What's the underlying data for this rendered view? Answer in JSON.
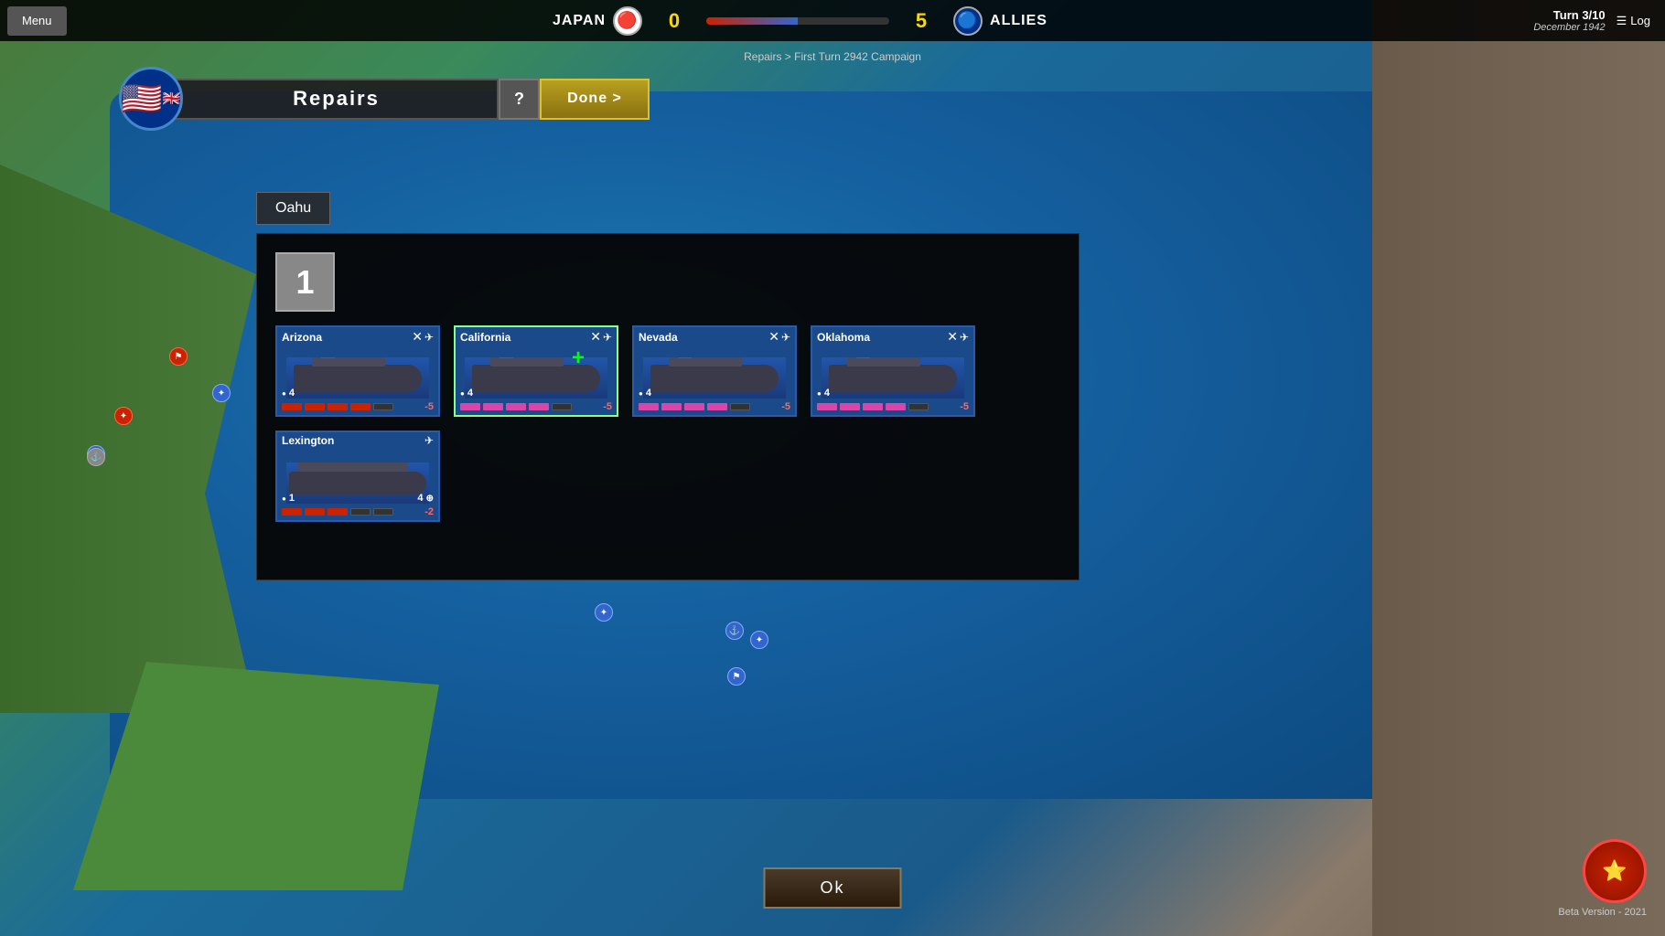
{
  "topbar": {
    "menu_label": "Menu",
    "japan_label": "JAPAN",
    "japan_score": "0",
    "allies_label": "ALLIES",
    "allies_score": "5",
    "turn_label": "Turn 3/10",
    "date_label": "December 1942",
    "log_label": "Log"
  },
  "breadcrumb": {
    "text": "Repairs > First Turn 2942 Campaign"
  },
  "repairs_header": {
    "title": "Repairs",
    "help_label": "?",
    "done_label": "Done >"
  },
  "location": {
    "name": "Oahu"
  },
  "repair_counter": {
    "value": "1"
  },
  "ships": [
    {
      "name": "Arizona",
      "stat_left": "4",
      "stat_right": "",
      "damage": "-5",
      "type": "battleship",
      "pips": [
        "red",
        "red",
        "red",
        "red",
        "empty"
      ],
      "selected": false
    },
    {
      "name": "California",
      "stat_left": "4",
      "stat_right": "",
      "damage": "-5",
      "type": "battleship",
      "pips": [
        "pink",
        "pink",
        "pink",
        "pink",
        "empty"
      ],
      "selected": true,
      "repairing": true
    },
    {
      "name": "Nevada",
      "stat_left": "4",
      "stat_right": "",
      "damage": "-5",
      "type": "battleship",
      "pips": [
        "pink",
        "pink",
        "pink",
        "pink",
        "empty"
      ],
      "selected": false
    },
    {
      "name": "Oklahoma",
      "stat_left": "4",
      "stat_right": "",
      "damage": "-5",
      "type": "battleship",
      "pips": [
        "pink",
        "pink",
        "pink",
        "pink",
        "empty"
      ],
      "selected": false
    },
    {
      "name": "Lexington",
      "stat_left": "1",
      "stat_right": "4",
      "damage": "-2",
      "type": "carrier",
      "pips": [
        "red",
        "red",
        "red",
        "empty",
        "empty"
      ],
      "selected": false
    }
  ],
  "ok_button": {
    "label": "Ok"
  },
  "logo": {
    "text": "Beta Version - 2021"
  }
}
